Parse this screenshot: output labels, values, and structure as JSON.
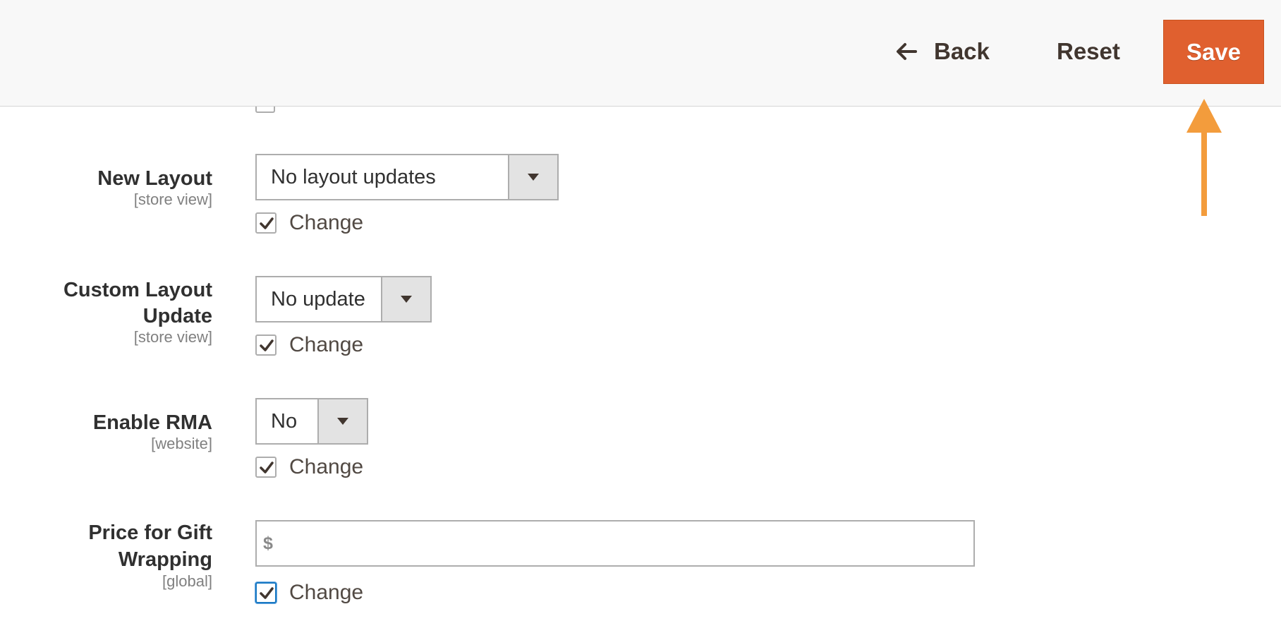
{
  "header": {
    "back_label": "Back",
    "reset_label": "Reset",
    "save_label": "Save"
  },
  "colors": {
    "save_button": "#e0602f",
    "annotation_arrow": "#f39c3c",
    "header_bg": "#f8f8f8"
  },
  "annotation": {
    "icon": "up-arrow-icon",
    "points_to": "save-button"
  },
  "fields": {
    "new_layout": {
      "label": "New Layout",
      "scope": "[store view]",
      "value": "No layout updates",
      "change_label": "Change",
      "change_checked": true
    },
    "custom_layout_update": {
      "label_line1": "Custom Layout",
      "label_line2": "Update",
      "scope": "[store view]",
      "value": "No update",
      "change_label": "Change",
      "change_checked": true
    },
    "enable_rma": {
      "label": "Enable RMA",
      "scope": "[website]",
      "value": "No",
      "change_label": "Change",
      "change_checked": true
    },
    "price_gift_wrapping": {
      "label_line1": "Price for Gift",
      "label_line2": "Wrapping",
      "scope": "[global]",
      "currency_symbol": "$",
      "value": "",
      "change_label": "Change",
      "change_checked": true
    }
  }
}
